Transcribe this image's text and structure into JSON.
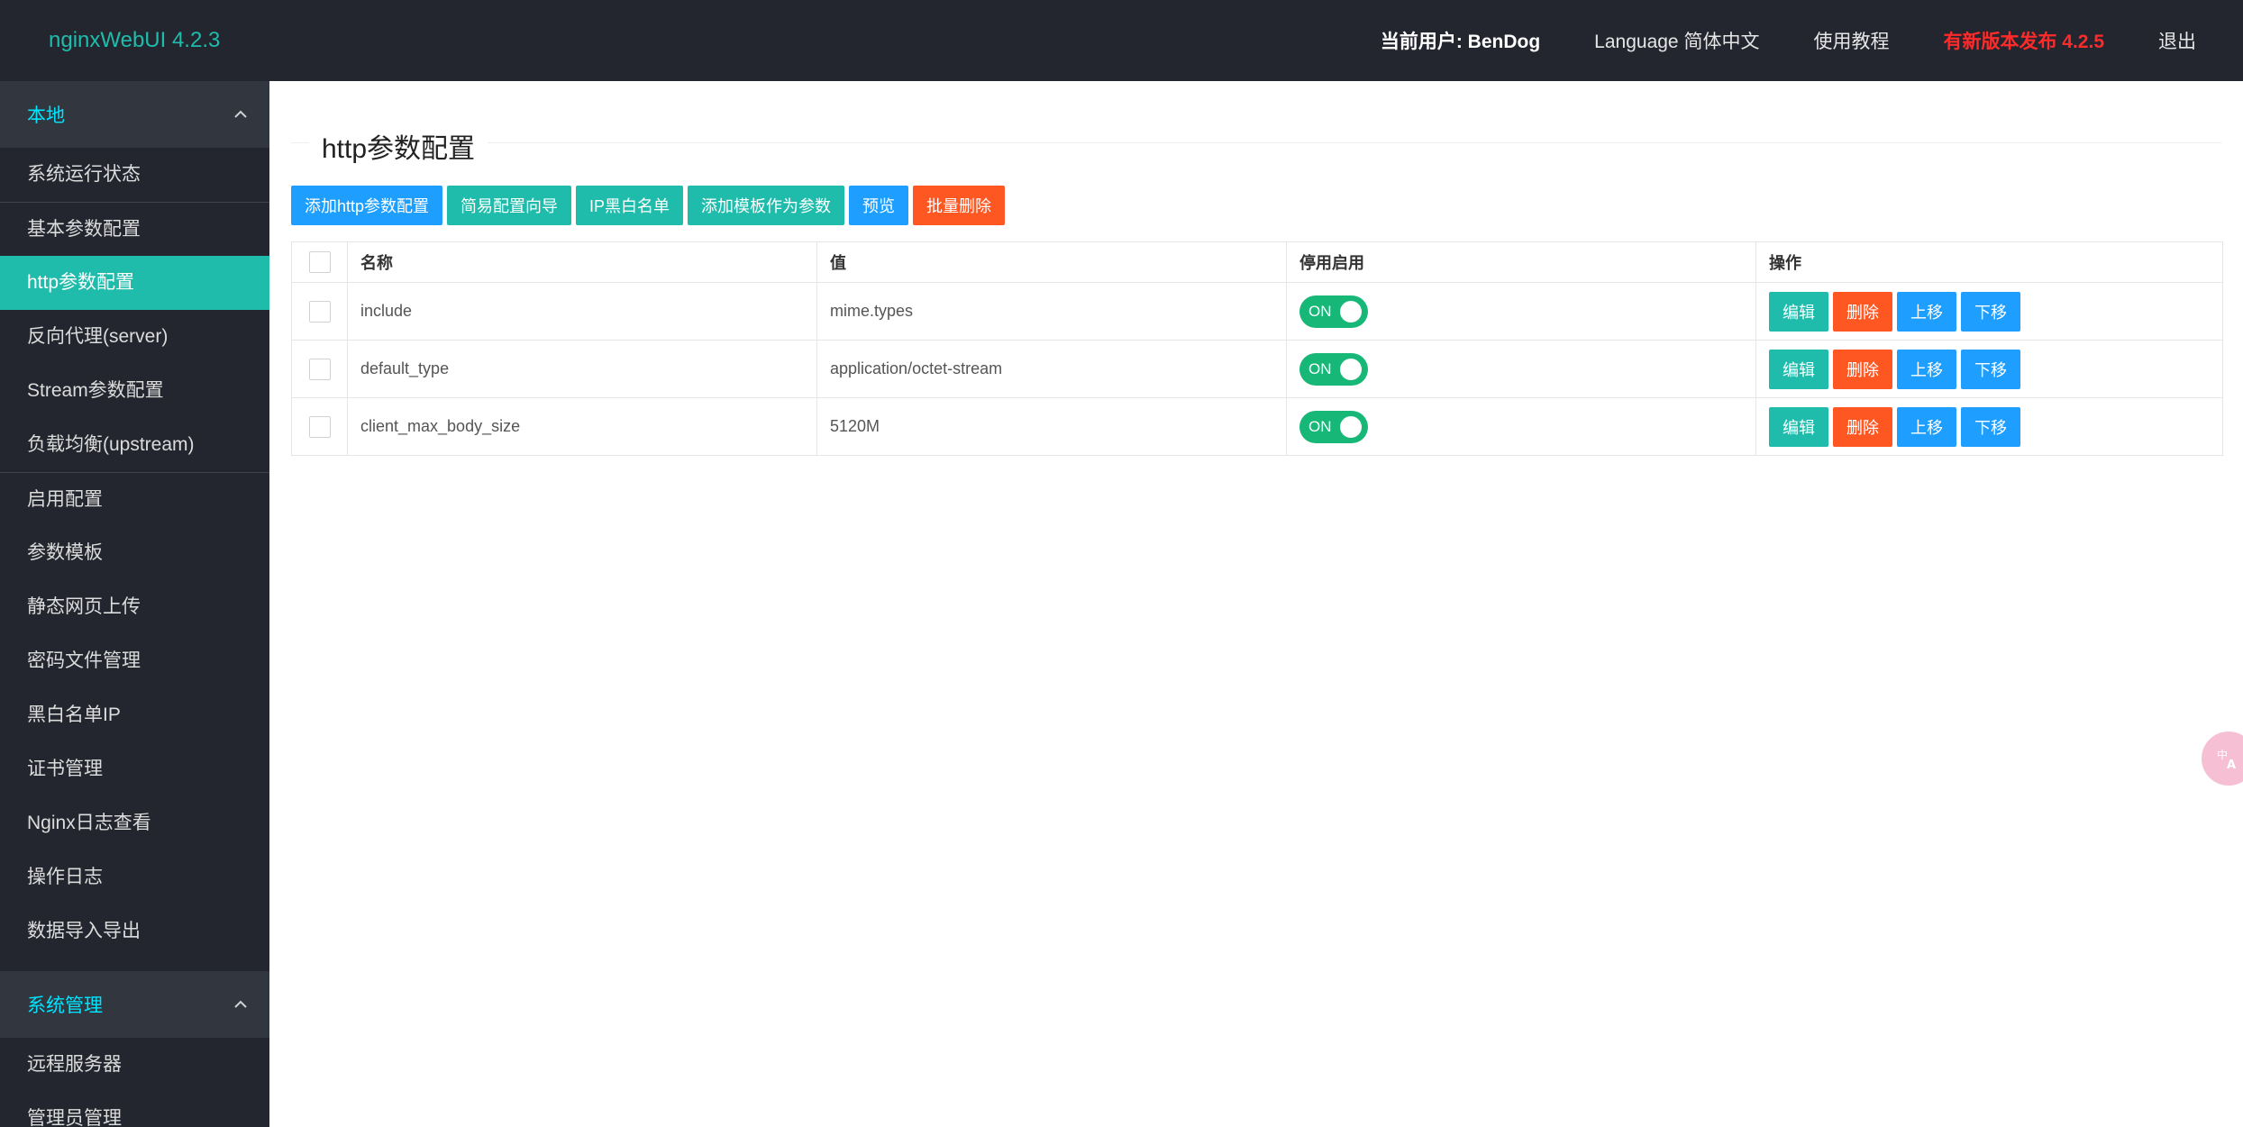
{
  "app": {
    "logo": "nginxWebUI 4.2.3"
  },
  "topnav": {
    "current_user": "当前用户: BenDog",
    "language": "Language 简体中文",
    "tutorial": "使用教程",
    "release": "有新版本发布 4.2.5",
    "logout": "退出"
  },
  "sidebar": {
    "group_local": "本地",
    "items": [
      "系统运行状态",
      "基本参数配置",
      "http参数配置",
      "反向代理(server)",
      "Stream参数配置",
      "负载均衡(upstream)",
      "启用配置",
      "参数模板",
      "静态网页上传",
      "密码文件管理",
      "黑白名单IP",
      "证书管理",
      "Nginx日志查看",
      "操作日志",
      "数据导入导出"
    ],
    "group_system": "系统管理",
    "system_items": [
      "远程服务器",
      "管理员管理"
    ]
  },
  "main": {
    "title": "http参数配置",
    "toolbar": {
      "add": "添加http参数配置",
      "wizard": "简易配置向导",
      "ip_list": "IP黑白名单",
      "add_template": "添加模板作为参数",
      "preview": "预览",
      "batch_delete": "批量删除"
    },
    "table": {
      "headers": {
        "name": "名称",
        "value": "值",
        "enabled": "停用启用",
        "ops": "操作"
      },
      "rows": [
        {
          "name": "include",
          "value": "mime.types",
          "switch": "ON"
        },
        {
          "name": "default_type",
          "value": "application/octet-stream",
          "switch": "ON"
        },
        {
          "name": "client_max_body_size",
          "value": "5120M",
          "switch": "ON"
        }
      ],
      "row_ops": {
        "edit": "编辑",
        "delete": "删除",
        "up": "上移",
        "down": "下移"
      }
    }
  },
  "colors": {
    "header_bg": "#23262e",
    "accent_teal": "#1fbcab",
    "blue": "#1e9fff",
    "orange": "#ff5722",
    "switch_on": "#16b777",
    "release_red": "#ff2a2a"
  }
}
